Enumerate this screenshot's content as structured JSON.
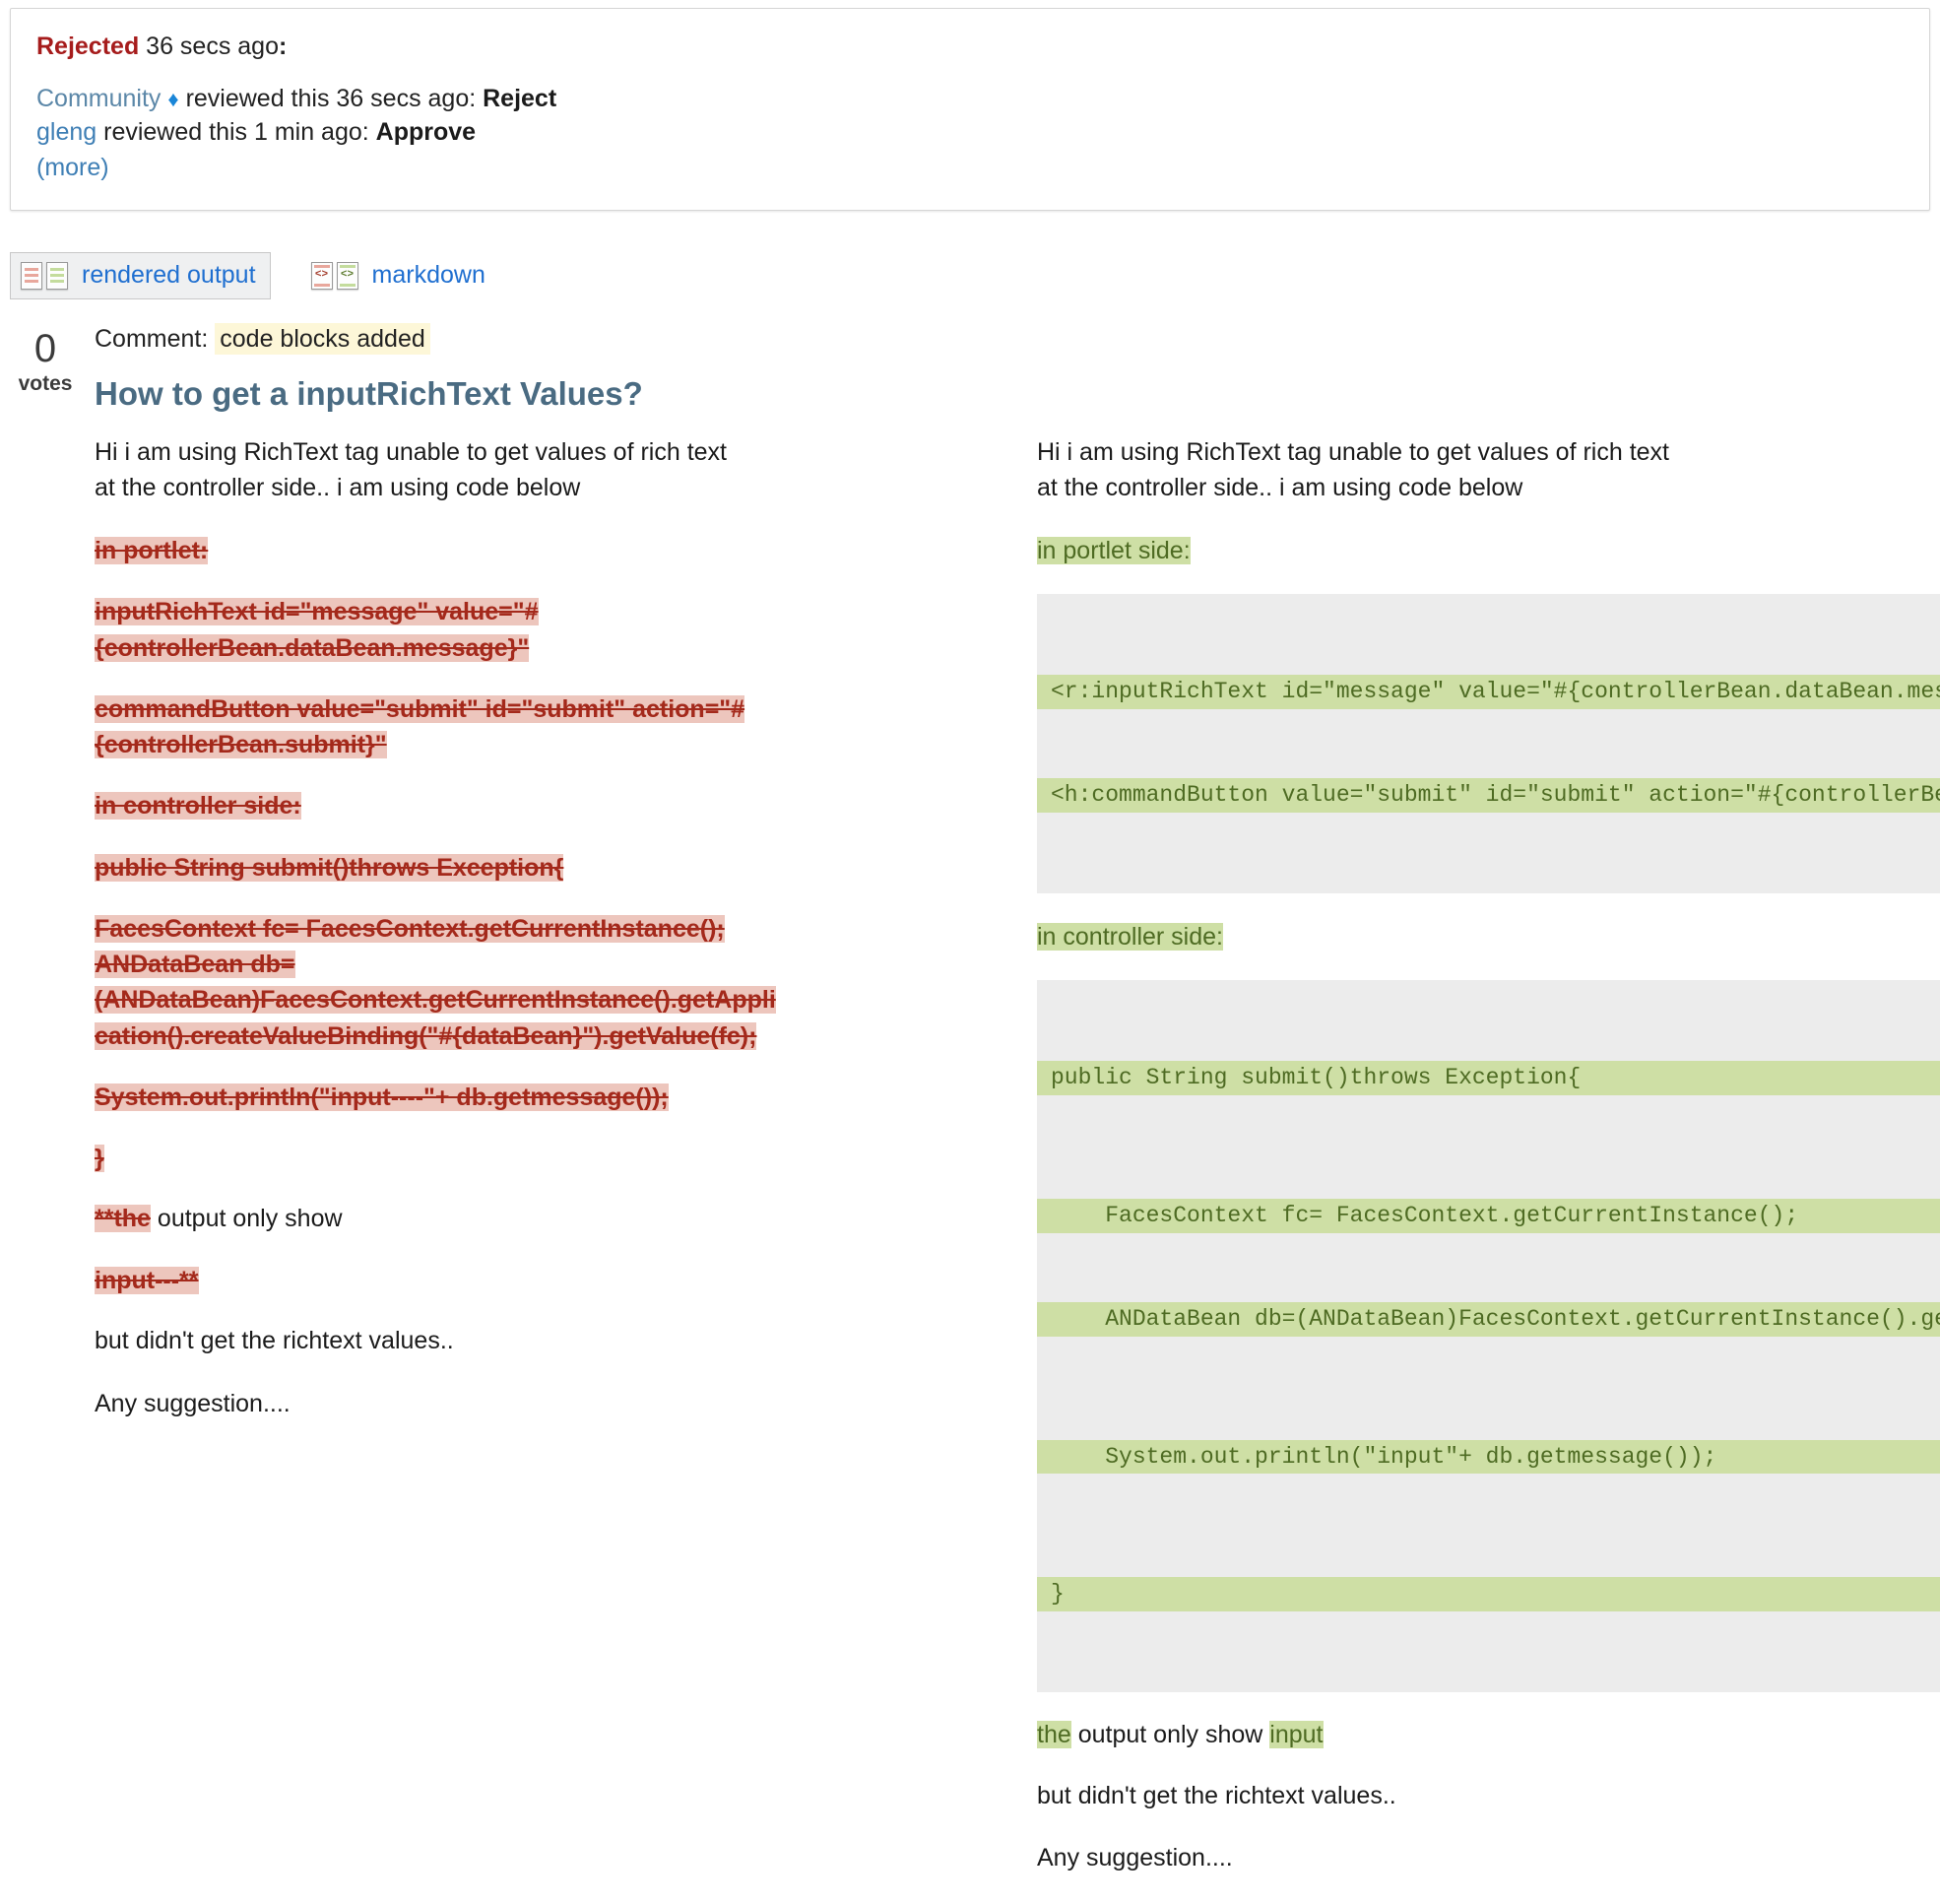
{
  "review_banner": {
    "status": "Rejected",
    "status_time": "36 secs ago",
    "status_colon": ":",
    "reviews": [
      {
        "user": "Community",
        "is_moderator": true,
        "diamond": "♦",
        "middle": "reviewed this 36 secs ago:",
        "verdict": "Reject"
      },
      {
        "user": "gleng",
        "is_moderator": false,
        "diamond": "",
        "middle": "reviewed this 1 min ago:",
        "verdict": "Approve"
      }
    ],
    "more_label": "(more)"
  },
  "view_tabs": [
    {
      "label": "rendered output",
      "selected": true,
      "icon": "side-by-side-doc-icon"
    },
    {
      "label": "markdown",
      "selected": false,
      "icon": "side-by-side-code-icon"
    }
  ],
  "post": {
    "votes": "0",
    "votes_label": "votes",
    "comment_label": "Comment:",
    "comment_value": "code blocks added",
    "title": "How to get a inputRichText Values?"
  },
  "diff": {
    "left": {
      "intro": "Hi i am using RichText tag unable to get values of rich text at the controller side.. i am using code below",
      "blocks": [
        {
          "type": "deleted",
          "text": "in portlet:"
        },
        {
          "type": "deleted",
          "text": "inputRichText id=\"message\" value=\"#{controllerBean.dataBean.message}\""
        },
        {
          "type": "deleted",
          "text": "commandButton value=\"submit\" id=\"submit\" action=\"#{controllerBean.submit}\""
        },
        {
          "type": "deleted",
          "text": "in controller side:"
        },
        {
          "type": "deleted",
          "text": "public String submit()throws Exception{"
        },
        {
          "type": "deleted",
          "text": "FacesContext fc= FacesContext.getCurrentInstance(); ANDataBean db= (ANDataBean)FacesContext.getCurrentInstance().getApplication().createValueBinding(\"#{dataBean}\").getValue(fc);"
        },
        {
          "type": "deleted",
          "text": "System.out.println(\"input----\"+ db.getmessage());"
        },
        {
          "type": "deleted",
          "text": "}"
        },
        {
          "type": "mixed",
          "deleted": "**the",
          "kept": " output only show"
        },
        {
          "type": "deleted",
          "text": "input---**"
        },
        {
          "type": "plain",
          "text": "but didn't get the richtext values.."
        },
        {
          "type": "plain",
          "text": "Any suggestion...."
        }
      ]
    },
    "right": {
      "intro": "Hi i am using RichText tag unable to get values of rich text at the controller side.. i am using code below",
      "blocks": [
        {
          "type": "inserted",
          "text": "in portlet side:"
        },
        {
          "type": "code",
          "lines": [
            {
              "text": "<r:inputRichText id=\"message\" value=\"#{controllerBean.dataBean.message}\"/>",
              "added": true
            },
            {
              "text": "<h:commandButton value=\"submit\" id=\"submit\" action=\"#{controllerBean.submit}\"/>",
              "added": true
            }
          ]
        },
        {
          "type": "inserted",
          "text": "in controller side:"
        },
        {
          "type": "code",
          "lines": [
            {
              "text": "public String submit()throws Exception{",
              "added": true
            },
            {
              "text": "",
              "added": false
            },
            {
              "text": "    FacesContext fc= FacesContext.getCurrentInstance();",
              "added": true
            },
            {
              "text": "    ANDataBean db=(ANDataBean)FacesContext.getCurrentInstance().getApplication()",
              "added": true
            },
            {
              "text": "",
              "added": false
            },
            {
              "text": "    System.out.println(\"input\"+ db.getmessage());",
              "added": true
            },
            {
              "text": "",
              "added": false
            },
            {
              "text": "}",
              "added": true
            }
          ]
        },
        {
          "type": "mixed",
          "inserted_head": "the",
          "kept_mid": " output only show ",
          "inserted_tail": "input"
        },
        {
          "type": "plain",
          "text": "but didn't get the richtext values.."
        },
        {
          "type": "plain",
          "text": "Any suggestion...."
        }
      ]
    }
  },
  "colors": {
    "rejected": "#a61c1c",
    "link": "#3f7fb5",
    "tab_link": "#1f6fd0",
    "title": "#4a6b82",
    "deleted_bg": "#edc6bd",
    "deleted_fg": "#a4291b",
    "inserted_bg": "#cedfa5",
    "inserted_fg": "#4e6b23",
    "code_bg": "#ececec",
    "comment_highlight": "#fdf7d8"
  }
}
